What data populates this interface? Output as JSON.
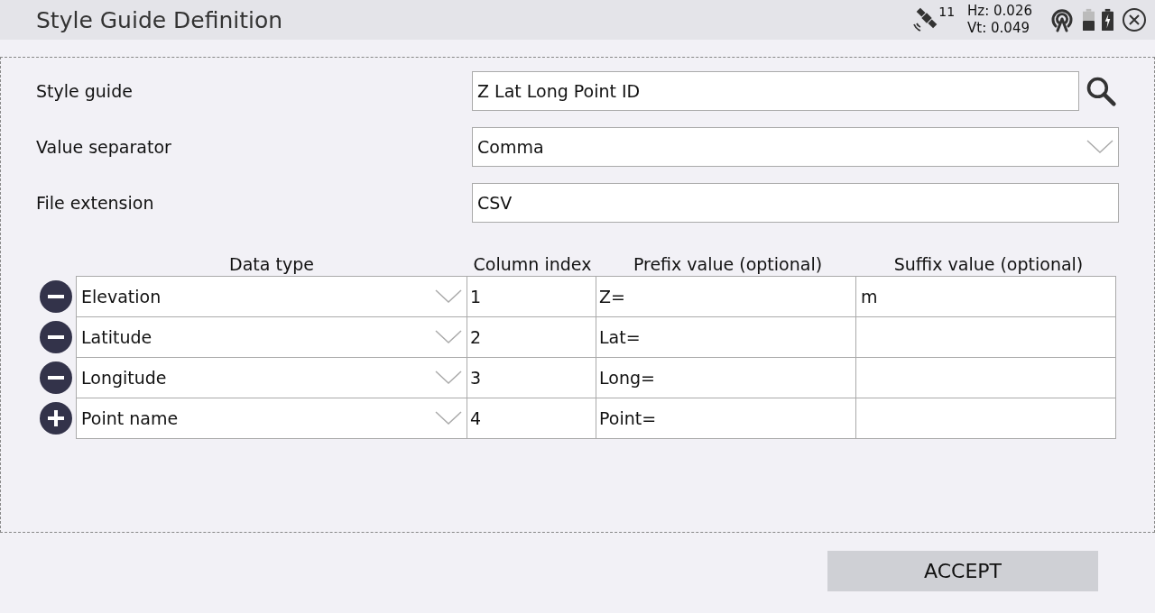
{
  "window": {
    "title": "Style Guide Definition"
  },
  "status": {
    "satellites": "11",
    "hz": "Hz: 0.026",
    "vt": "Vt: 0.049"
  },
  "form": [
    {
      "label": "Style guide",
      "kind": "search",
      "value": "Z Lat Long Point ID"
    },
    {
      "label": "Value separator",
      "kind": "dropdown",
      "value": "Comma"
    },
    {
      "label": "File extension",
      "kind": "text",
      "value": "CSV"
    }
  ],
  "table": {
    "columns": [
      "Data type",
      "Column index",
      "Prefix value (optional)",
      "Suffix value (optional)"
    ],
    "rows": [
      {
        "kind": "remove",
        "data_type": "Elevation",
        "index": "1",
        "prefix": "Z=",
        "suffix": "m"
      },
      {
        "kind": "remove",
        "data_type": "Latitude",
        "index": "2",
        "prefix": "Lat=",
        "suffix": ""
      },
      {
        "kind": "remove",
        "data_type": "Longitude",
        "index": "3",
        "prefix": "Long=",
        "suffix": ""
      },
      {
        "kind": "add",
        "data_type": "Point name",
        "index": "4",
        "prefix": "Point=",
        "suffix": ""
      }
    ]
  },
  "buttons": [
    "ACCEPT"
  ]
}
